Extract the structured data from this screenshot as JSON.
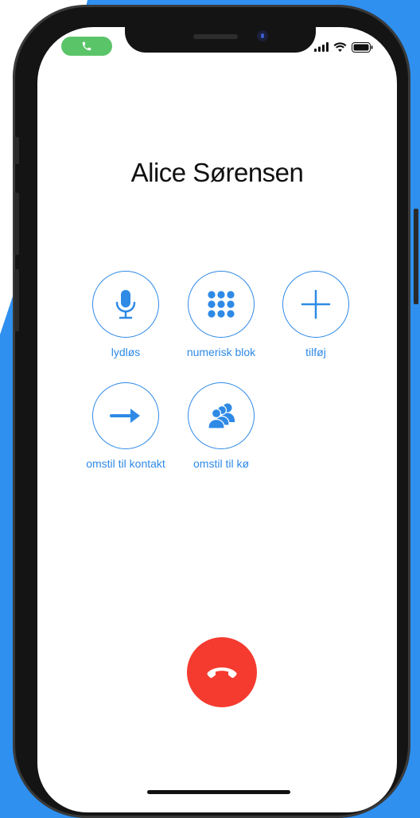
{
  "call": {
    "caller_name": "Alice Sørensen"
  },
  "controls": [
    {
      "label": "lydløs",
      "icon": "microphone-icon"
    },
    {
      "label": "numerisk blok",
      "icon": "keypad-icon"
    },
    {
      "label": "tilføj",
      "icon": "plus-icon"
    },
    {
      "label": "omstil til kontakt",
      "icon": "arrow-right-icon"
    },
    {
      "label": "omstil til kø",
      "icon": "group-icon"
    }
  ],
  "colors": {
    "accent": "#2f8ae6",
    "end_call": "#f53b30",
    "active_call_pill": "#5ac468",
    "background_brand": "#2f90f0"
  }
}
